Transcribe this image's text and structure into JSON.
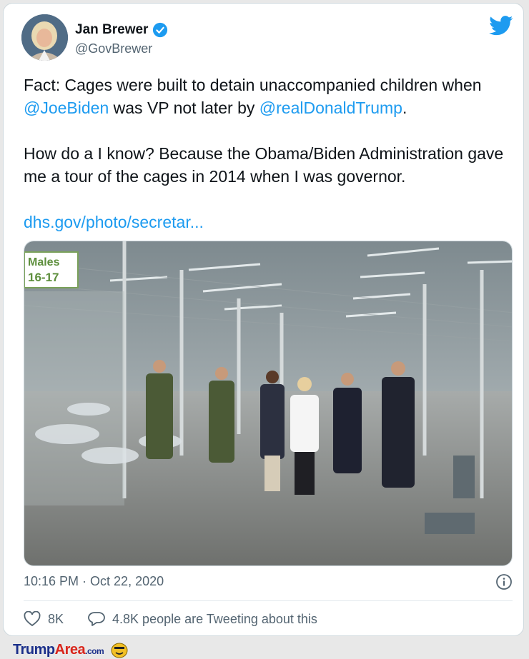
{
  "tweet": {
    "author": {
      "name": "Jan Brewer",
      "handle": "@GovBrewer",
      "verified": true
    },
    "paragraph1": {
      "part1": "Fact:  Cages were built to detain unaccompanied children when ",
      "mention1": "@JoeBiden",
      "part2": "  was VP not later by ",
      "mention2": "@realDonaldTrump",
      "part3": "."
    },
    "paragraph2": "How do a I know? Because the Obama/Biden Administration gave me a tour of the cages in 2014 when I was governor.",
    "link": "dhs.gov/photo/secretar...",
    "photo": {
      "sign_line1": "Males",
      "sign_line2": "16-17"
    },
    "timestamp": "10:16 PM · Oct 22, 2020",
    "likes": "8K",
    "replies_text": "4.8K people are Tweeting about this"
  },
  "watermark": {
    "part1": "Trump",
    "part2": "Area",
    "part3": ".com"
  },
  "colors": {
    "link": "#1d9bf0",
    "twitter_blue": "#1d9bf0",
    "muted": "#536471"
  },
  "icons": [
    "verified-badge-icon",
    "twitter-bird-icon",
    "info-icon",
    "heart-icon",
    "reply-bubble-icon",
    "smiley-icon"
  ]
}
